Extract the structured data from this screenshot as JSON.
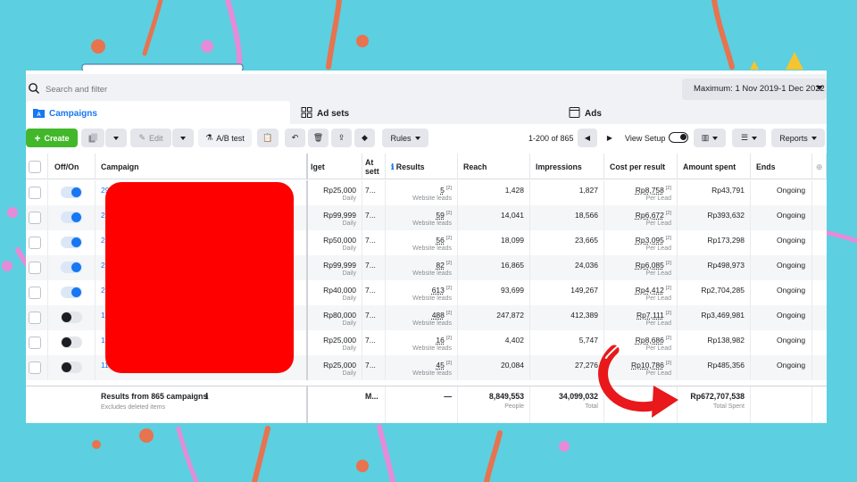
{
  "search": {
    "placeholder": "Search and filter"
  },
  "date_range": "Maximum: 1 Nov 2019-1 Dec 2022",
  "tabs": [
    {
      "label": "Campaigns"
    },
    {
      "label": "Ad sets"
    },
    {
      "label": "Ads"
    }
  ],
  "toolbar": {
    "create_label": "Create",
    "edit_label": "Edit",
    "ab_test_label": "A/B test",
    "rules_label": "Rules",
    "pagination": "1-200 of 865",
    "view_setup_label": "View Setup",
    "reports_label": "Reports"
  },
  "columns": {
    "off_on": "Off/On",
    "campaign": "Campaign",
    "budget": "lget",
    "attribution": "At sett",
    "results": "Results",
    "reach": "Reach",
    "impressions": "Impressions",
    "cost_per_result": "Cost per result",
    "amount_spent": "Amount spent",
    "ends": "Ends"
  },
  "rows": [
    {
      "on": true,
      "campaign": "29.1",
      "budget": "Rp25,000",
      "budget_type": "Daily",
      "attr": "7...",
      "results": "5",
      "result_type": "Website leads",
      "reach": "1,428",
      "impressions": "1,827",
      "cpr": "Rp8,758",
      "cpr_type": "Per Lead",
      "spent": "Rp43,791",
      "ends": "Ongoing"
    },
    {
      "on": true,
      "campaign": "2",
      "budget": "Rp99,999",
      "budget_type": "Daily",
      "attr": "7...",
      "results": "59",
      "result_type": "Website leads",
      "reach": "14,041",
      "impressions": "18,566",
      "cpr": "Rp6,672",
      "cpr_type": "Per Lead",
      "spent": "Rp393,632",
      "ends": "Ongoing"
    },
    {
      "on": true,
      "campaign": "2",
      "budget": "Rp50,000",
      "budget_type": "Daily",
      "attr": "7...",
      "results": "56",
      "result_type": "Website leads",
      "reach": "18,099",
      "impressions": "23,665",
      "cpr": "Rp3,095",
      "cpr_type": "Per Lead",
      "spent": "Rp173,298",
      "ends": "Ongoing"
    },
    {
      "on": true,
      "campaign": "2",
      "budget": "Rp99,999",
      "budget_type": "Daily",
      "attr": "7...",
      "results": "82",
      "result_type": "Website leads",
      "reach": "16,865",
      "impressions": "24,036",
      "cpr": "Rp6,085",
      "cpr_type": "Per Lead",
      "spent": "Rp498,973",
      "ends": "Ongoing"
    },
    {
      "on": true,
      "campaign": "2",
      "budget": "Rp40,000",
      "budget_type": "Daily",
      "attr": "7...",
      "results": "613",
      "result_type": "Website leads",
      "reach": "93,699",
      "impressions": "149,267",
      "cpr": "Rp4,412",
      "cpr_type": "Per Lead",
      "spent": "Rp2,704,285",
      "ends": "Ongoing"
    },
    {
      "on": false,
      "campaign": "1",
      "budget": "Rp80,000",
      "budget_type": "Daily",
      "attr": "7...",
      "results": "488",
      "result_type": "Website leads",
      "reach": "247,872",
      "impressions": "412,389",
      "cpr": "Rp7,111",
      "cpr_type": "Per Lead",
      "spent": "Rp3,469,981",
      "ends": "Ongoing"
    },
    {
      "on": false,
      "campaign": "1",
      "budget": "Rp25,000",
      "budget_type": "Daily",
      "attr": "7...",
      "results": "16",
      "result_type": "Website leads",
      "reach": "4,402",
      "impressions": "5,747",
      "cpr": "Rp8,686",
      "cpr_type": "Per Lead",
      "spent": "Rp138,982",
      "ends": "Ongoing"
    },
    {
      "on": false,
      "campaign": "11",
      "budget": "Rp25,000",
      "budget_type": "Daily",
      "attr": "7...",
      "results": "45",
      "result_type": "Website leads",
      "reach": "20,084",
      "impressions": "27,276",
      "cpr": "Rp10,786",
      "cpr_type": "Per Lead",
      "spent": "Rp485,356",
      "ends": "Ongoing"
    }
  ],
  "footer": {
    "title": "Results from 865 campaigns",
    "subtitle": "Excludes deleted items",
    "attr": "M...",
    "results": "—",
    "reach": "8,849,553",
    "reach_sub": "People",
    "impressions": "34,099,032",
    "impressions_sub": "Total",
    "cpr": "—",
    "spent": "Rp672,707,538",
    "spent_sub": "Total Spent"
  },
  "colors": {
    "background": "#5ccfe0",
    "accent_blue": "#1877f2",
    "create_green": "#42b72a",
    "redaction": "#ff0000",
    "arrow": "#e8181b"
  }
}
